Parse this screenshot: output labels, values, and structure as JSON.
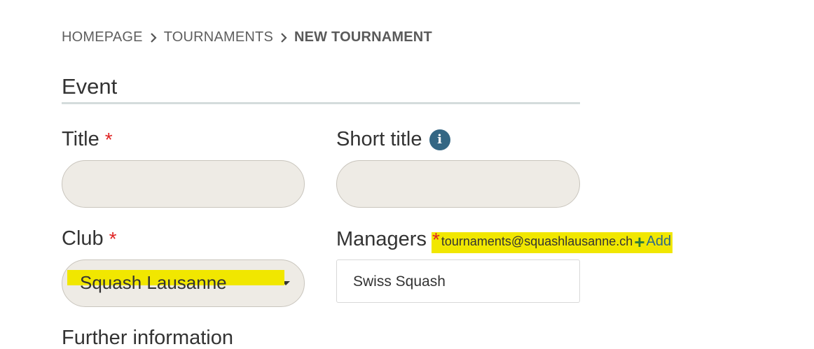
{
  "breadcrumb": {
    "items": [
      "HOMEPAGE",
      "TOURNAMENTS"
    ],
    "current": "NEW TOURNAMENT"
  },
  "section": {
    "title": "Event"
  },
  "fields": {
    "title": {
      "label": "Title",
      "required_mark": "*",
      "value": ""
    },
    "short_title": {
      "label": "Short title",
      "info_icon": "i",
      "value": ""
    },
    "club": {
      "label": "Club",
      "required_mark": "*",
      "selected": "Squash Lausanne"
    },
    "managers": {
      "label": "Managers",
      "required_mark": "*",
      "current_email": "tournaments@squashlausanne.ch",
      "add_icon": "+",
      "add_label": "Add",
      "input_value": "Swiss Squash"
    },
    "further_info": {
      "label": "Further information"
    }
  },
  "colors": {
    "required": "#e02424",
    "accent": "#346784",
    "highlight": "#f1e700",
    "field_bg": "#eeebe5"
  }
}
